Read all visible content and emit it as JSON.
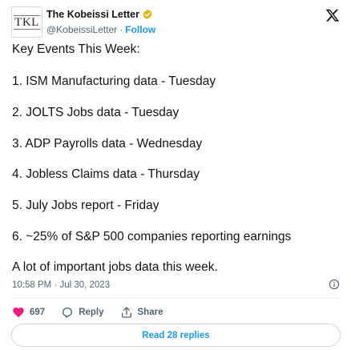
{
  "author": {
    "avatar_text": "TKL",
    "name": "The Kobeissi Letter",
    "handle": "@KobeissiLetter",
    "separator": "·",
    "follow_label": "Follow"
  },
  "tweet": {
    "lines": [
      "Key Events This Week:",
      "1. ISM Manufacturing data - Tuesday",
      "2. JOLTS Jobs data - Tuesday",
      "3. ADP Payrolls data - Wednesday",
      "4. Jobless Claims data - Thursday",
      "5. July Jobs report - Friday",
      "6. ~25% of S&P 500 companies reporting earnings",
      "A lot of important jobs data this week."
    ],
    "timestamp": "10:58 PM · Jul 30, 2023"
  },
  "actions": {
    "like_count": "697",
    "reply_label": "Reply",
    "share_label": "Share"
  },
  "read_replies_label": "Read 28 replies",
  "colors": {
    "accent": "#1d9bf0",
    "like": "#f91880",
    "text": "#0f1419",
    "muted": "#536471",
    "verified": "#e2b719"
  }
}
